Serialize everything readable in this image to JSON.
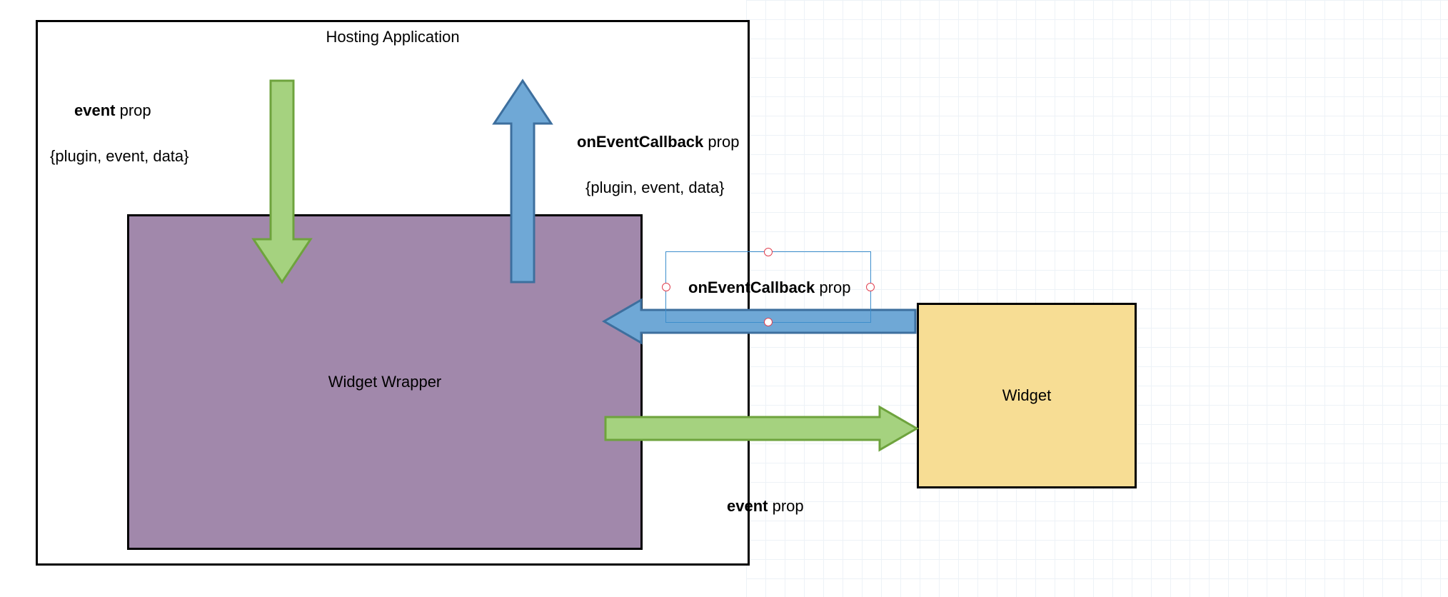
{
  "hosting": {
    "title": "Hosting Application"
  },
  "wrapper": {
    "title": "Widget Wrapper"
  },
  "widget": {
    "title": "Widget"
  },
  "labels": {
    "event_prop_top_bold": "event",
    "event_prop_top_rest": " prop",
    "event_prop_top_sub": "{plugin, event, data}",
    "on_event_cb_top_bold": "onEventCallback",
    "on_event_cb_top_rest": " prop",
    "on_event_cb_top_sub": "{plugin, event, data}",
    "on_event_cb_mid_bold": "onEventCallback",
    "on_event_cb_mid_rest": " prop",
    "event_prop_bottom_bold": "event",
    "event_prop_bottom_rest": " prop"
  },
  "colors": {
    "green_fill": "#a5d27f",
    "green_stroke": "#6ea33d",
    "blue_fill": "#6fa8d6",
    "blue_stroke": "#3d6f9e",
    "purple": "#a188ab",
    "yellow": "#f7dd94"
  }
}
